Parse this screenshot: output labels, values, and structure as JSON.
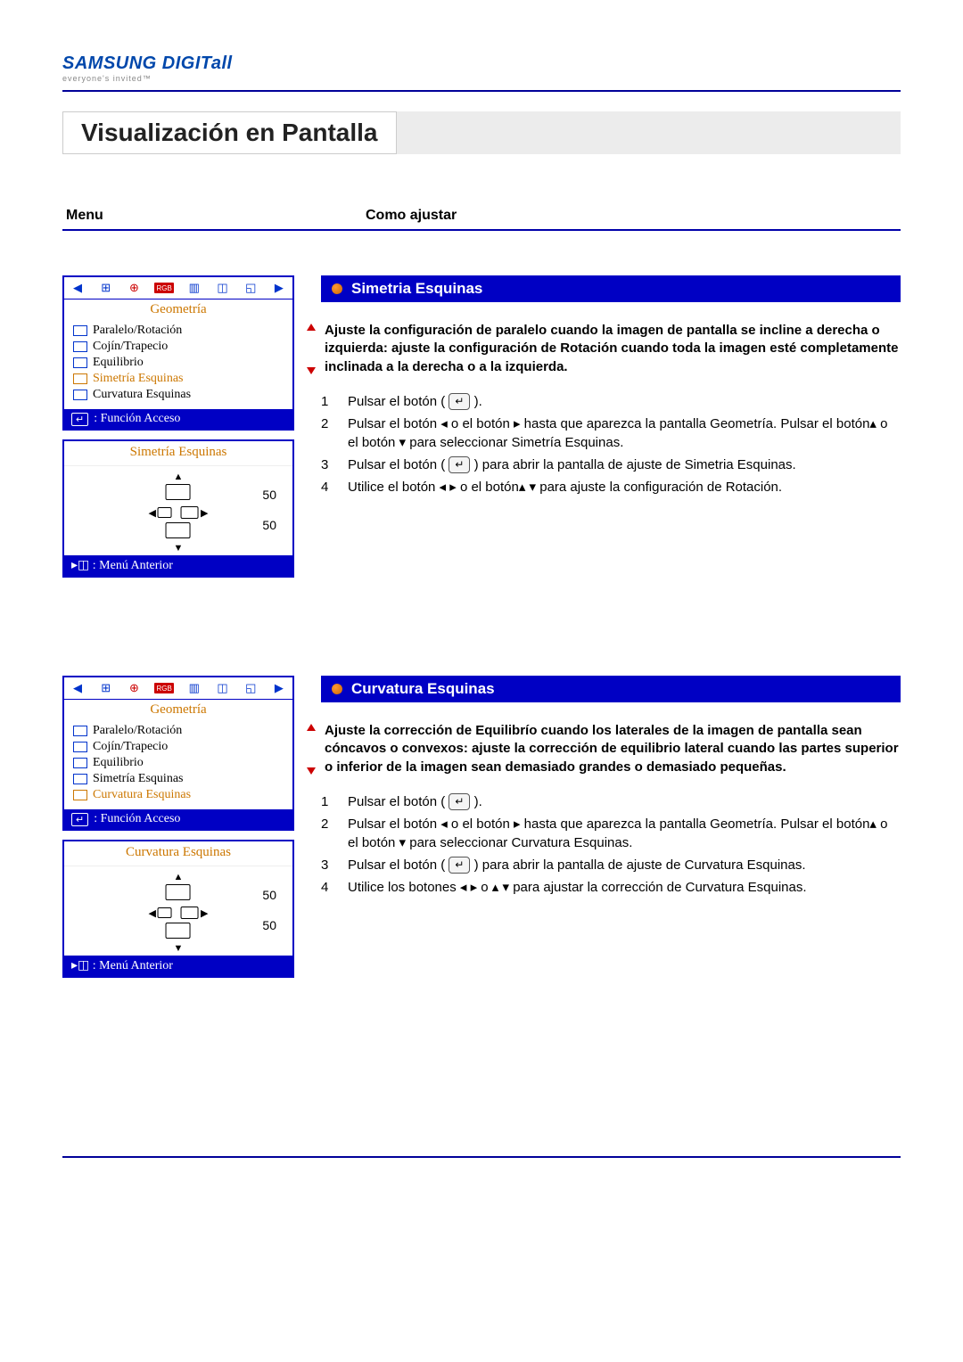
{
  "logo": {
    "brand": "SAMSUNG DIGITall",
    "tagline": "everyone's invited™"
  },
  "page_title": "Visualización en Pantalla",
  "columns": {
    "menu": "Menu",
    "como_ajustar": "Como ajustar"
  },
  "osd": {
    "tab": "Geometría",
    "items": [
      "Paralelo/Rotación",
      "Cojín/Trapecio",
      "Equilibrio",
      "Simetría Esquinas",
      "Curvatura Esquinas"
    ],
    "footer": ": Función Acceso",
    "menu_anterior": ": Menú Anterior",
    "rgb_label": "RGB"
  },
  "sections": [
    {
      "id": "simetria",
      "title": "Simetria Esquinas",
      "active_index": 3,
      "adjust_title": "Simetría Esquinas",
      "values": {
        "v1": "50",
        "v2": "50"
      },
      "description": "Ajuste la configuración de paralelo cuando la imagen de pantalla se incline a derecha o izquierda: ajuste la configuración de Rotación cuando toda la imagen esté completamente inclinada a la derecha o a la izquierda.",
      "steps": [
        "Pulsar el botón (  ).",
        "Pulsar el botón ◂  o el botón ▸  hasta que aparezca la pantalla Geometría. Pulsar el botón▴  o el botón  ▾  para seleccionar Simetría Esquinas.",
        "Pulsar el botón (  ) para abrir la pantalla de ajuste de Simetria Esquinas.",
        "Utilice el botón ◂ ▸ o el botón▴ ▾  para ajuste la configuración de Rotación."
      ]
    },
    {
      "id": "curvatura",
      "title": "Curvatura Esquinas",
      "active_index": 4,
      "adjust_title": "Curvatura Esquinas",
      "values": {
        "v1": "50",
        "v2": "50"
      },
      "description": "Ajuste la corrección de Equilibrío cuando los laterales de la imagen de pantalla sean cóncavos o convexos: ajuste la corrección de equilibrio lateral cuando las partes superior o inferior de la imagen sean demasiado grandes o demasiado pequeñas.",
      "steps": [
        "Pulsar el botón (  ).",
        "Pulsar el botón ◂  o el botón ▸  hasta que aparezca la pantalla Geometría. Pulsar el botón▴  o el botón ▾  para seleccionar Curvatura Esquinas.",
        "Pulsar el botón (  ) para abrir la pantalla de ajuste de Curvatura Esquinas.",
        "Utilice los botones ◂ ▸  o ▴ ▾  para ajustar la corrección de Curvatura Esquinas."
      ]
    }
  ]
}
